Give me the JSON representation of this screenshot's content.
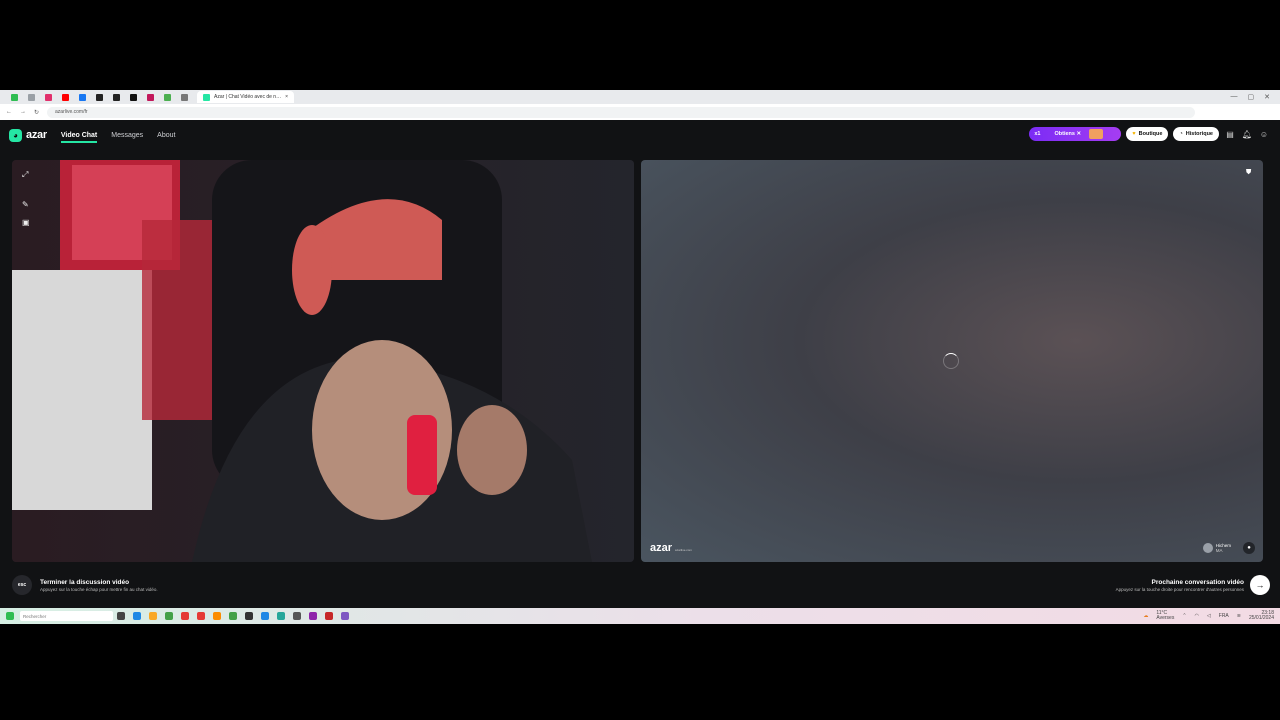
{
  "browser": {
    "active_tab_title": "Azar | Chat Vidéo avec de n…",
    "url": "azarlive.com/fr",
    "tab_close": "×",
    "nav_back": "←",
    "nav_forward": "→",
    "nav_reload": "↻",
    "window_controls": [
      "—",
      "▢",
      "✕"
    ]
  },
  "app": {
    "logo_text": "azar",
    "nav": [
      {
        "label": "Video Chat",
        "active": true
      },
      {
        "label": "Messages",
        "active": false
      },
      {
        "label": "About",
        "active": false
      }
    ],
    "promo": {
      "badge": "x1",
      "label": "Obtiens ✕"
    },
    "shop_label": "Boutique",
    "history_label": "Historique"
  },
  "remote": {
    "watermark": "azar",
    "watermark_sub": "azarlive.com",
    "user_name": "Hichem",
    "user_sub": "MA"
  },
  "footer": {
    "esc_key": "esc",
    "end_title": "Terminer la discussion vidéo",
    "end_sub": "Appuyez sur la touche échap pour mettre fin au chat vidéo.",
    "next_title": "Prochaine conversation vidéo",
    "next_sub": "Appuyez sur la touche droite pour rencontrer d'autres personnes",
    "next_arrow": "→"
  },
  "taskbar": {
    "search_placeholder": "Rechercher",
    "weather": "11°C",
    "weather_sub": "Averses",
    "lang": "FRA",
    "time": "23:18",
    "date": "25/01/2024"
  },
  "colors": {
    "accent": "#25e6a4",
    "promo": "#8a33f4",
    "app_bg": "#111214"
  }
}
